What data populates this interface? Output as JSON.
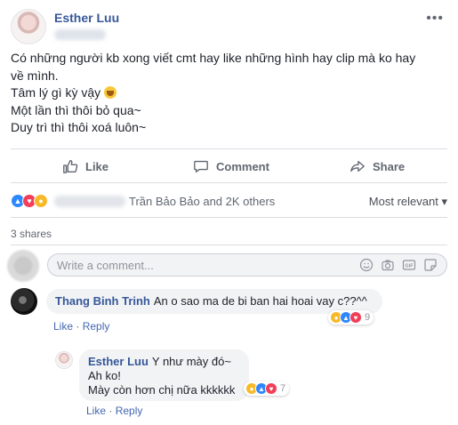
{
  "post": {
    "author": "Esther Luu",
    "more_label": "•••",
    "text_lines": [
      "Có những người kb xong viết cmt hay like những hình hay clip mà ko hay",
      "về mình.",
      "Tâm lý gì kỳ vậy",
      "Một lần thì thôi bỏ qua~",
      "Duy trì thì thôi xoá luôn~"
    ]
  },
  "actions": {
    "like": "Like",
    "comment": "Comment",
    "share": "Share"
  },
  "reactions": {
    "summary": "Trần Bảo Bảo and 2K others",
    "sort": "Most relevant"
  },
  "shares": "3 shares",
  "comment_input": {
    "placeholder": "Write a comment..."
  },
  "comments": [
    {
      "author": "Thang Binh Trinh",
      "text": "An o sao ma de bi ban hai hoai vay c??^^",
      "like": "Like",
      "reply": "Reply",
      "reaction_count": "9"
    }
  ],
  "reply": {
    "author": "Esther Luu",
    "lines": [
      "Y như mày đó~",
      "Ah ko!",
      "Mày còn hơn chị nữa kkkkkk"
    ],
    "like": "Like",
    "reply": "Reply",
    "reaction_count": "7"
  },
  "colors": {
    "link": "#365899",
    "muted": "#606770",
    "like_blue": "#2d88ff",
    "love_red": "#f33e58",
    "haha_yellow": "#f7b928"
  }
}
